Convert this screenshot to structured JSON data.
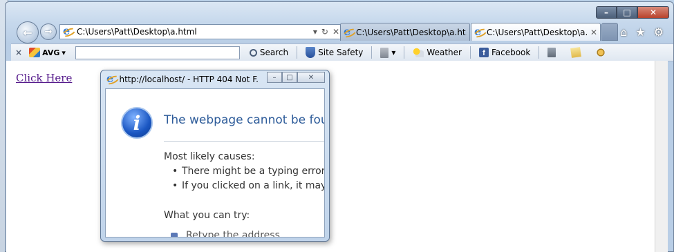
{
  "browser": {
    "address_url": "C:\\Users\\Patt\\Desktop\\a.html",
    "tabs": [
      {
        "title": "C:\\Users\\Patt\\Desktop\\a.ht...",
        "active": false
      },
      {
        "title": "C:\\Users\\Patt\\Desktop\\a...",
        "active": true
      }
    ],
    "caption": {
      "minimize": "–",
      "maximize": "□",
      "close": "✕"
    },
    "right_icons": {
      "home": "⌂",
      "favorites": "★",
      "tools": "⚙"
    }
  },
  "toolbar": {
    "close": "×",
    "avg_label": "AVG",
    "search_label": "Search",
    "site_safety_label": "Site Safety",
    "weather_label": "Weather",
    "facebook_label": "Facebook"
  },
  "page": {
    "link_text": "Click Here"
  },
  "popup": {
    "title": "http://localhost/ - HTTP 404 Not F...",
    "heading": "The webpage cannot be found",
    "causes_heading": "Most likely causes:",
    "causes": [
      "There might be a typing error in the address.",
      "If you clicked on a link, it may be out of date."
    ],
    "try_heading": "What you can try:",
    "try_first": "Retype the address."
  },
  "colors": {
    "link_visited": "#551a8b",
    "heading_blue": "#2e5c9a"
  }
}
